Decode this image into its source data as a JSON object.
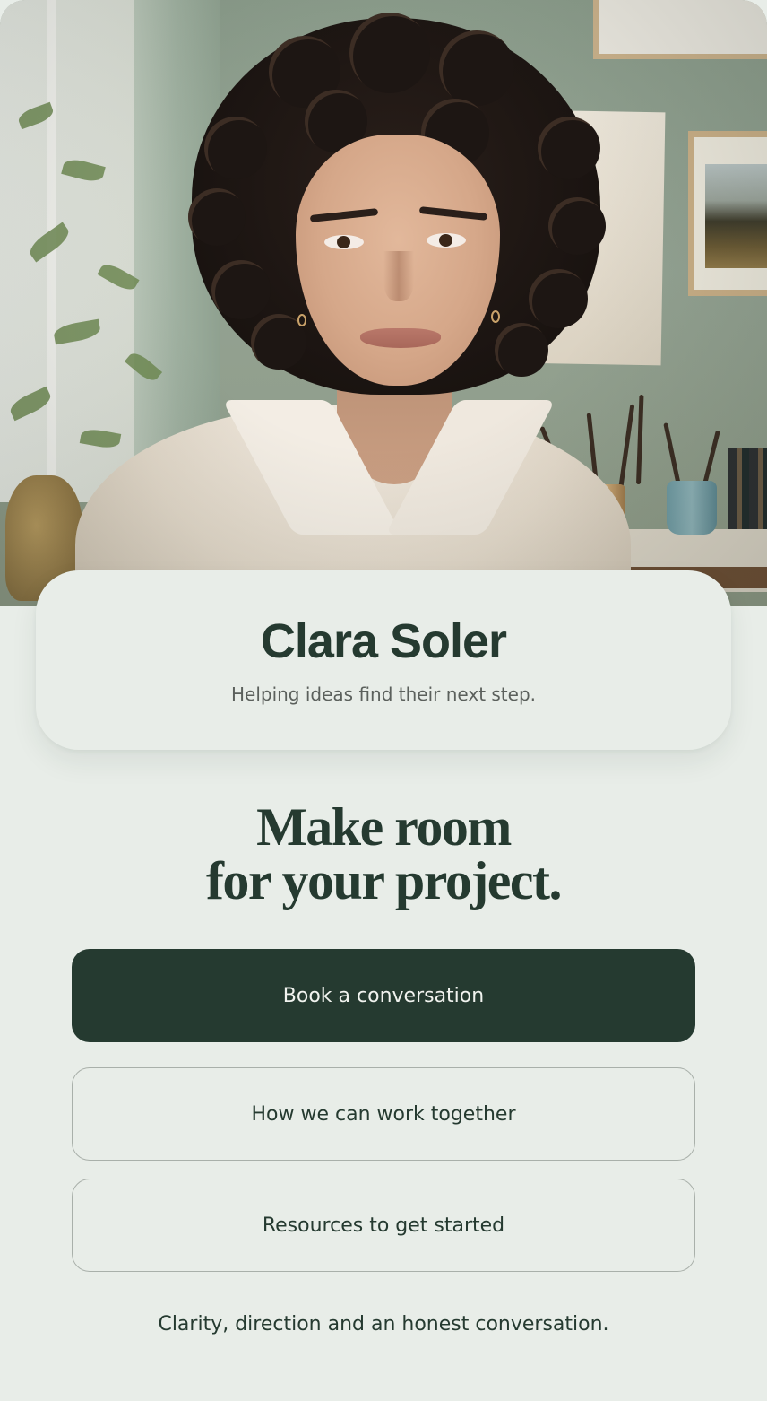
{
  "profile": {
    "name": "Clara Soler",
    "tagline": "Helping ideas find their next step.",
    "photo_icon": "portrait-photo"
  },
  "headline": {
    "line1": "Make room",
    "line2": "for your project."
  },
  "buttons": {
    "primary_label": "Book a conversation",
    "secondary_label": "How we can work together",
    "tertiary_label": "Resources to get started"
  },
  "footer": {
    "text": "Clarity, direction and an honest conversation."
  },
  "colors": {
    "background": "#e8ede8",
    "primary": "#253a30",
    "text_muted": "#5b605c",
    "border": "#a9b0aa"
  }
}
